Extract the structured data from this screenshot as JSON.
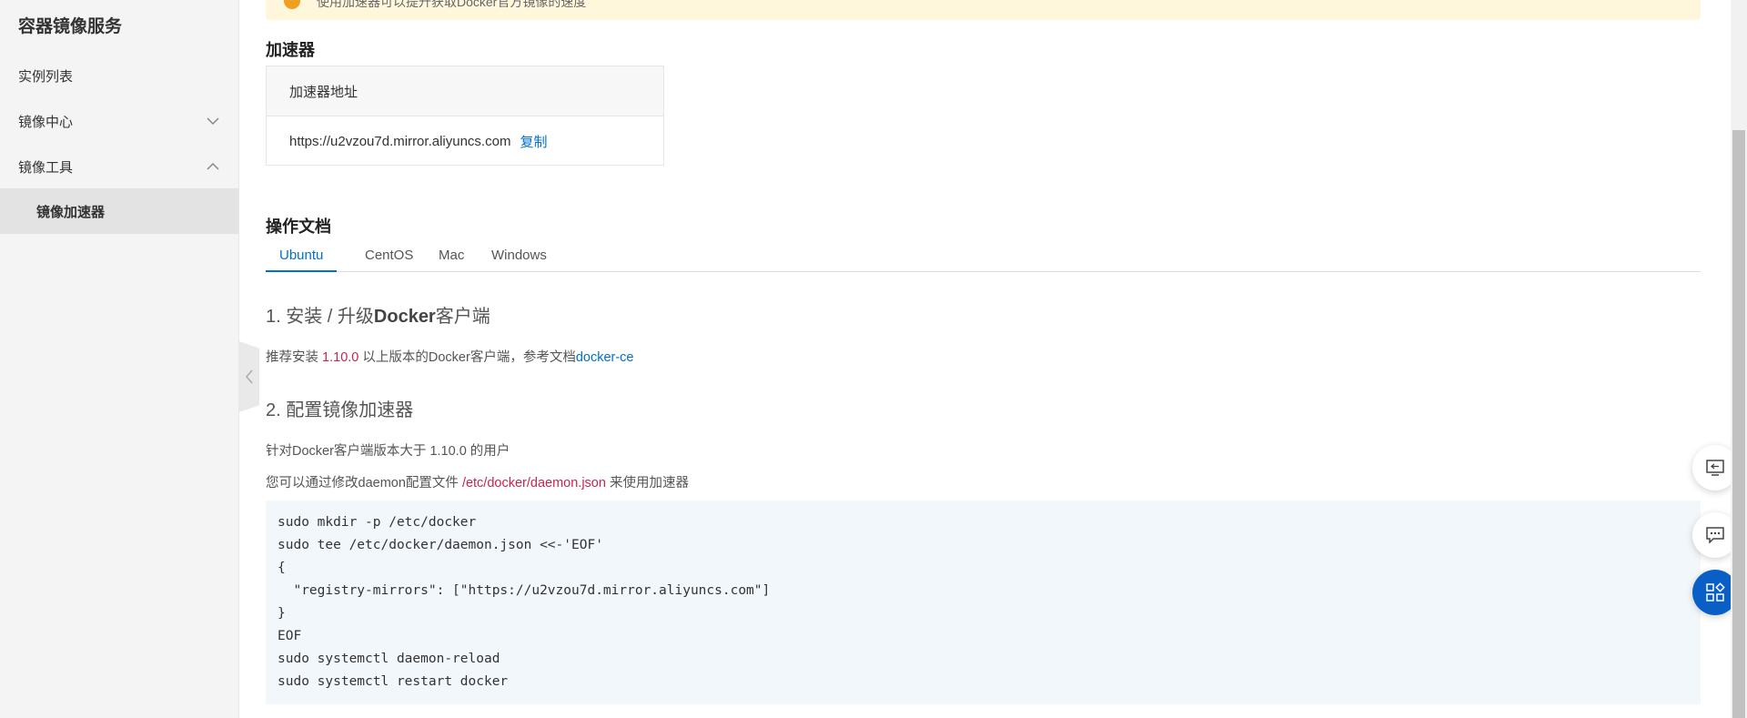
{
  "sidebar": {
    "title": "容器镜像服务",
    "items": [
      {
        "label": "实例列表"
      },
      {
        "label": "镜像中心"
      },
      {
        "label": "镜像工具"
      },
      {
        "label": "镜像加速器"
      }
    ]
  },
  "notice": {
    "text": "使用加速器可以提升获取Docker官方镜像的速度"
  },
  "accelerator": {
    "title": "加速器",
    "header": "加速器地址",
    "url": "https://u2vzou7d.mirror.aliyuncs.com",
    "copy_label": "复制"
  },
  "docs": {
    "title": "操作文档",
    "tabs": [
      {
        "label": "Ubuntu"
      },
      {
        "label": "CentOS"
      },
      {
        "label": "Mac"
      },
      {
        "label": "Windows"
      }
    ],
    "step1": {
      "prefix": "1. 安装 / 升级",
      "bold": "Docker",
      "suffix": "客户端"
    },
    "step1_text": {
      "before": "推荐安装 ",
      "version": "1.10.0",
      "middle": " 以上版本的Docker客户端，参考文档",
      "link": "docker-ce"
    },
    "step2_title": "2. 配置镜像加速器",
    "step2_text1": "针对Docker客户端版本大于 1.10.0 的用户",
    "step2_text2": {
      "before": "您可以通过修改daemon配置文件 ",
      "path": "/etc/docker/daemon.json",
      "after": " 来使用加速器"
    },
    "code_lines": [
      "sudo mkdir -p /etc/docker",
      "sudo tee /etc/docker/daemon.json <<-'EOF'",
      "{",
      "  \"registry-mirrors\": [\"https://u2vzou7d.mirror.aliyuncs.com\"]",
      "}",
      "EOF",
      "sudo systemctl daemon-reload",
      "sudo systemctl restart docker"
    ]
  },
  "colors": {
    "accent": "#0070cc",
    "highlight": "#c7254e",
    "code_bg": "#f2f7fc",
    "notice_bg": "#fff7dc",
    "float_primary": "#0a5fc7"
  },
  "icons": [
    "chevron-down-icon",
    "chevron-up-icon",
    "chevron-left-icon",
    "warning-icon",
    "monitor-icon",
    "chat-icon",
    "apps-icon"
  ]
}
